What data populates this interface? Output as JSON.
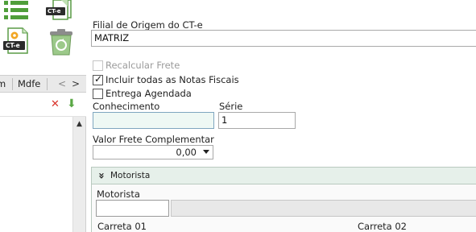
{
  "left_panel": {
    "icons": [
      {
        "name": "list-icon",
        "badge": ""
      },
      {
        "name": "cte-document-icon",
        "badge": "CT-e"
      },
      {
        "name": "cte-settings-icon",
        "badge": "CT-e"
      },
      {
        "name": "recycle-bin-icon",
        "badge": ""
      }
    ],
    "tabs": {
      "partial_label": "m",
      "mdfe_label": "Mdfe",
      "prev_glyph": "<",
      "next_glyph": ">"
    },
    "toolbar": {
      "delete_glyph": "✕",
      "download_glyph": "⬇"
    },
    "scroll_up_glyph": "▲"
  },
  "form": {
    "filial_label": "Filial de Origem do CT-e",
    "filial_value": "MATRIZ",
    "recalcular_label": "Recalcular Frete",
    "recalcular_checked": false,
    "incluir_label": "Incluir todas as Notas Fiscais",
    "incluir_checked": true,
    "entrega_label": "Entrega Agendada",
    "entrega_checked": false,
    "conhecimento_label": "Conhecimento",
    "conhecimento_value": "",
    "serie_label": "Série",
    "serie_value": "1",
    "valor_label": "Valor Frete Complementar",
    "valor_value": "0,00"
  },
  "motorista_panel": {
    "header": "Motorista",
    "collapse_glyph": "»",
    "motorista_label": "Motorista",
    "carreta1_label": "Carreta 01",
    "carreta2_label": "Carreta 02"
  },
  "colors": {
    "accent_green": "#5aa845",
    "danger_red": "#d9332b",
    "panel_header": "#e6f0ea",
    "focus_field": "#eef8f4"
  }
}
